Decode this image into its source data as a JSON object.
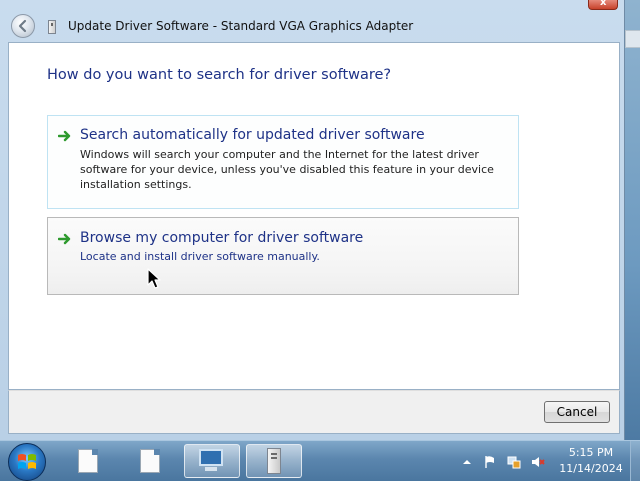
{
  "window": {
    "title": "Update Driver Software - Standard VGA Graphics Adapter",
    "close_label": "x"
  },
  "dialog": {
    "heading": "How do you want to search for driver software?",
    "options": [
      {
        "title": "Search automatically for updated driver software",
        "description": "Windows will search your computer and the Internet for the latest driver software for your device, unless you've disabled this feature in your device installation settings."
      },
      {
        "title": "Browse my computer for driver software",
        "description": "Locate and install driver software manually."
      }
    ],
    "cancel_label": "Cancel"
  },
  "taskbar": {
    "items": [
      "document-icon",
      "document-icon",
      "device-manager-icon",
      "computer-tower-icon"
    ],
    "tray_icons": [
      "show-hidden-icons-icon",
      "action-center-flag-icon",
      "network-icon",
      "volume-muted-icon"
    ],
    "clock": {
      "time": "5:15 PM",
      "date": "11/14/2024"
    }
  },
  "colors": {
    "link_blue": "#1e3287",
    "arrow_green": "#2e9a2e",
    "taskbar": "#5b86ae"
  }
}
